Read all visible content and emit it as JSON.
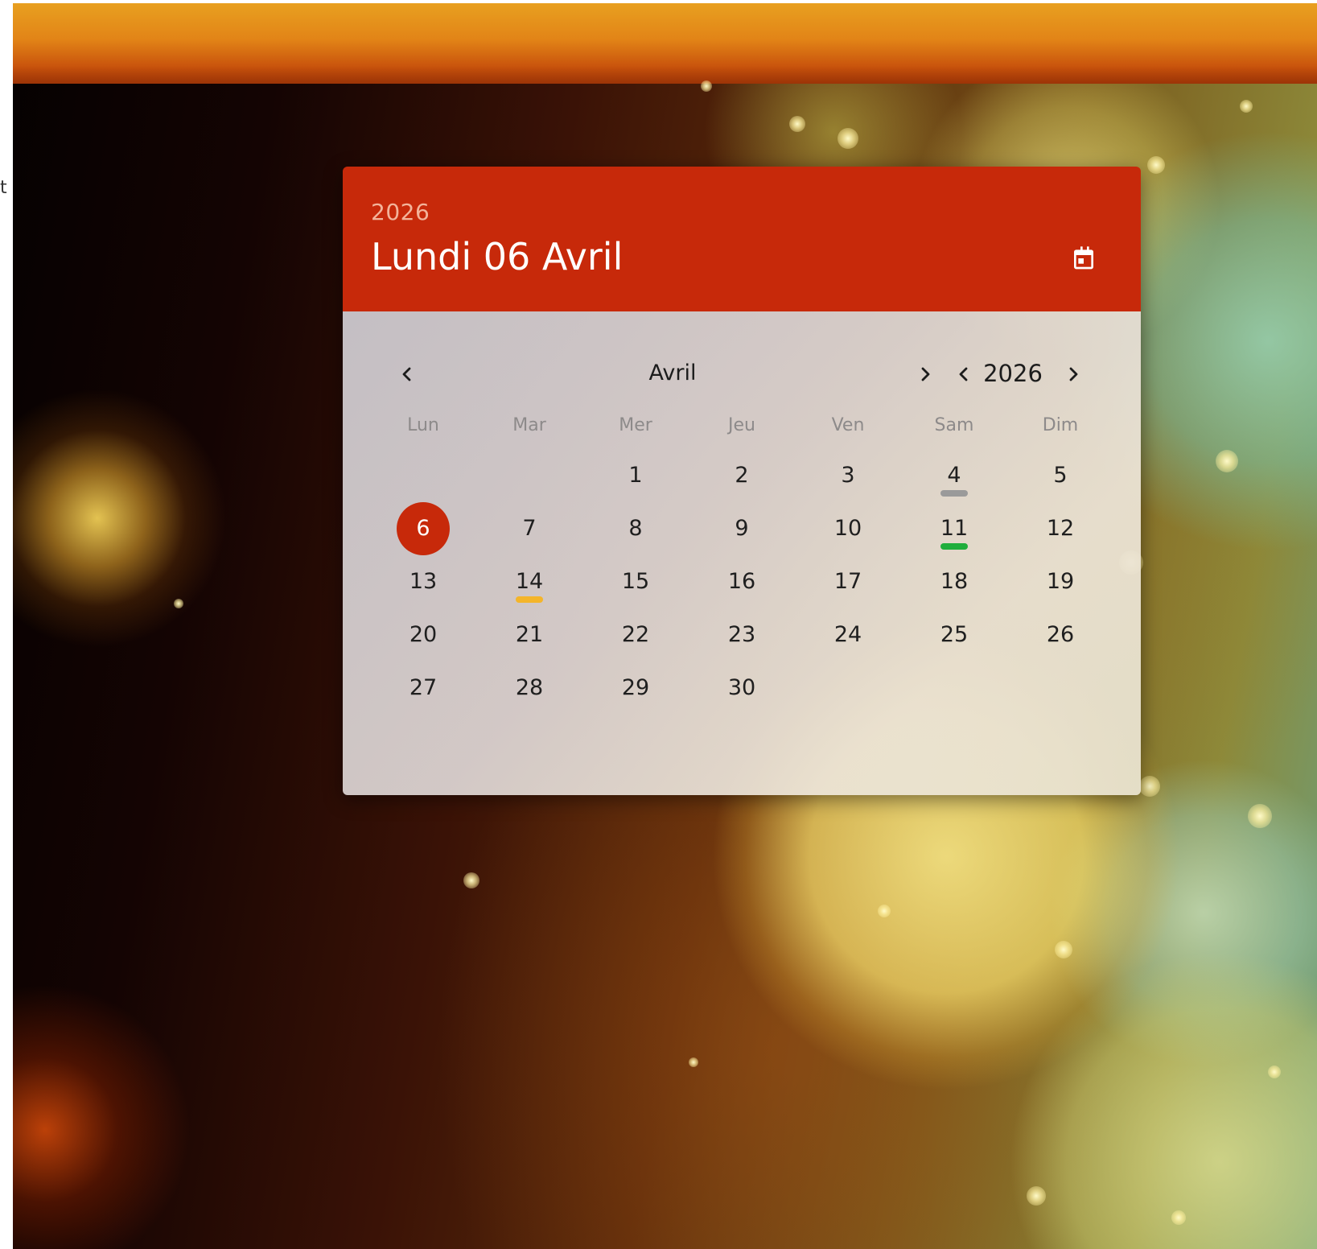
{
  "colors": {
    "accent": "#c7290a",
    "marker_gray": "#9a9a9a",
    "marker_green": "#1fae3c",
    "marker_yellow": "#f4b52a"
  },
  "header": {
    "year": "2026",
    "date_title": "Lundi 06 Avril",
    "calendar_icon": "calendar-icon"
  },
  "navigation": {
    "month": "Avril",
    "year": "2026",
    "prev_month_icon": "chevron-left-icon",
    "next_month_icon": "chevron-right-icon",
    "prev_year_icon": "chevron-left-icon",
    "next_year_icon": "chevron-right-icon"
  },
  "weekdays": [
    "Lun",
    "Mar",
    "Mer",
    "Jeu",
    "Ven",
    "Sam",
    "Dim"
  ],
  "days": [
    "1",
    "2",
    "3",
    "4",
    "5",
    "6",
    "7",
    "8",
    "9",
    "10",
    "11",
    "12",
    "13",
    "14",
    "15",
    "16",
    "17",
    "18",
    "19",
    "20",
    "21",
    "22",
    "23",
    "24",
    "25",
    "26",
    "27",
    "28",
    "29",
    "30"
  ],
  "first_weekday_index": 2,
  "selected_day": "6",
  "day_markers": [
    {
      "day": "4",
      "color": "gray"
    },
    {
      "day": "11",
      "color": "green"
    },
    {
      "day": "14",
      "color": "yellow"
    }
  ]
}
